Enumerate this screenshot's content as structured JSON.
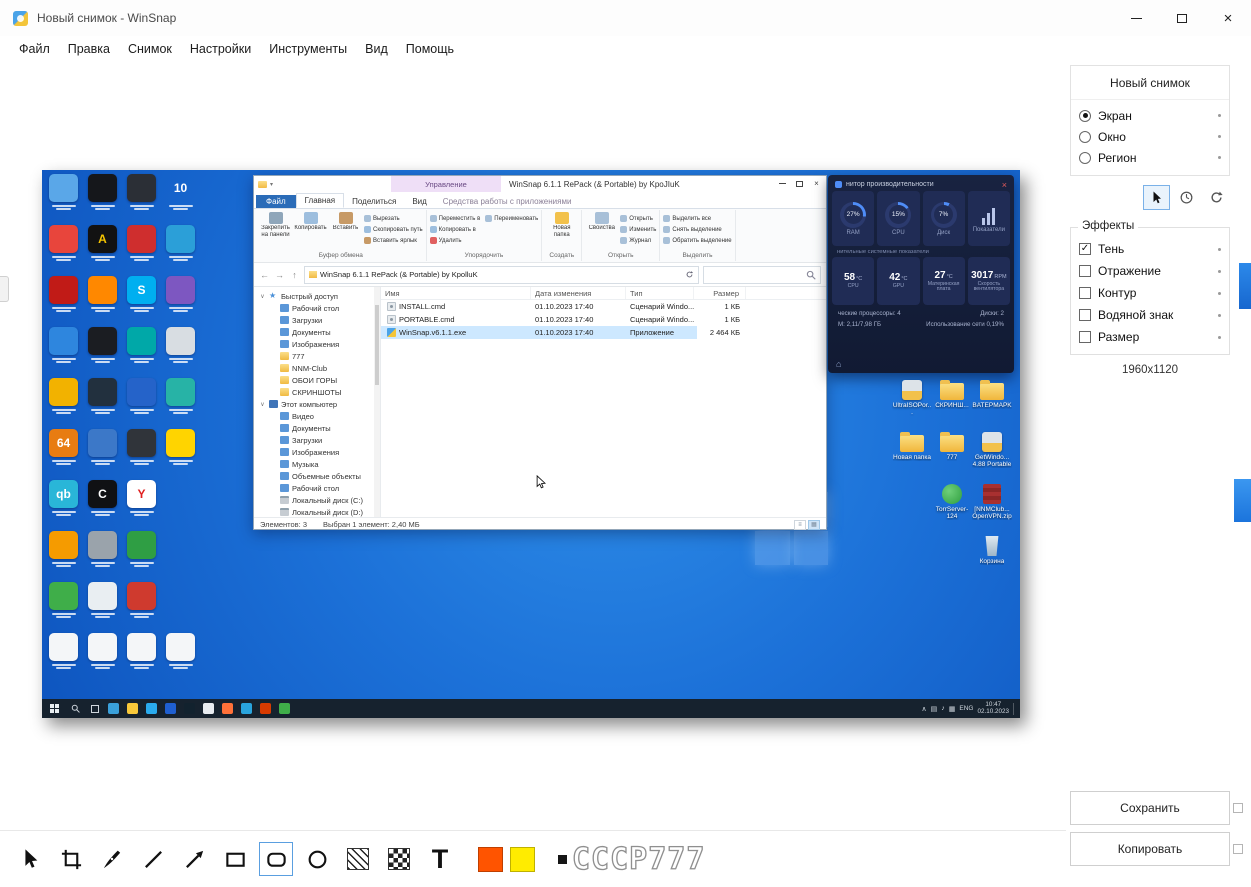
{
  "app": {
    "title": "Новый снимок - WinSnap",
    "close_glyph": "×"
  },
  "menu": {
    "items": [
      "Файл",
      "Правка",
      "Снимок",
      "Настройки",
      "Инструменты",
      "Вид",
      "Помощь"
    ]
  },
  "sidebar": {
    "capture": {
      "title": "Новый снимок",
      "modes": [
        {
          "label": "Экран",
          "selected": true
        },
        {
          "label": "Окно",
          "selected": false
        },
        {
          "label": "Регион",
          "selected": false
        }
      ]
    },
    "effects": {
      "title": "Эффекты",
      "items": [
        {
          "label": "Тень",
          "checked": true
        },
        {
          "label": "Отражение",
          "checked": false
        },
        {
          "label": "Контур",
          "checked": false
        },
        {
          "label": "Водяной знак",
          "checked": false
        },
        {
          "label": "Размер",
          "checked": false
        }
      ]
    },
    "resolution": "1960x1120",
    "save_label": "Сохранить",
    "copy_label": "Копировать"
  },
  "toolbar": {
    "text_tool_label": "T",
    "stroke_color": "#ff5400",
    "fill_color": "#ffec00",
    "font_sample": "CCCP777"
  },
  "preview": {
    "explorer": {
      "contextual_header": "Управление",
      "title": "WinSnap 6.1.1 RePack (& Portable) by KpoJIuK",
      "tabs": [
        {
          "label": "Файл",
          "kind": "file"
        },
        {
          "label": "Главная",
          "kind": "selected"
        },
        {
          "label": "Поделиться",
          "kind": "normal"
        },
        {
          "label": "Вид",
          "kind": "normal"
        },
        {
          "label": "Средства работы с приложениями",
          "kind": "contextual"
        }
      ],
      "ribbon_groups": [
        {
          "caption": "Буфер обмена",
          "big": [
            "Закрепить на панели быстрого доступа",
            "Копировать",
            "Вставить"
          ],
          "small": [
            "Вырезать",
            "Скопировать путь",
            "Вставить ярлык"
          ]
        },
        {
          "caption": "Упорядочить",
          "big": [],
          "small": [
            "Переместить в",
            "Копировать в",
            "Удалить",
            "Переименовать"
          ]
        },
        {
          "caption": "Создать",
          "big": [
            "Новая папка"
          ],
          "small": []
        },
        {
          "caption": "Открыть",
          "big": [
            "Свойства"
          ],
          "small": [
            "Открыть",
            "Изменить",
            "Журнал"
          ]
        },
        {
          "caption": "Выделить",
          "big": [],
          "small": [
            "Выделить все",
            "Снять выделение",
            "Обратить выделение"
          ]
        }
      ],
      "address": "WinSnap 6.1.1 RePack (& Portable) by KpolluK",
      "nav": [
        {
          "label": "Быстрый доступ",
          "icon": "star",
          "level": 0
        },
        {
          "label": "Рабочий стол",
          "icon": "desktop",
          "level": 1
        },
        {
          "label": "Загрузки",
          "icon": "download",
          "level": 1
        },
        {
          "label": "Документы",
          "icon": "doc",
          "level": 1
        },
        {
          "label": "Изображения",
          "icon": "pic",
          "level": 1
        },
        {
          "label": "777",
          "icon": "folder",
          "level": 1
        },
        {
          "label": "NNM-Club",
          "icon": "folder",
          "level": 1
        },
        {
          "label": "ОБОИ ГОРЫ",
          "icon": "folder",
          "level": 1
        },
        {
          "label": "СКРИНШОТЫ",
          "icon": "folder",
          "level": 1
        },
        {
          "label": "Этот компьютер",
          "icon": "pc",
          "level": 0
        },
        {
          "label": "Видео",
          "icon": "video",
          "level": 1
        },
        {
          "label": "Документы",
          "icon": "doc",
          "level": 1
        },
        {
          "label": "Загрузки",
          "icon": "download",
          "level": 1
        },
        {
          "label": "Изображения",
          "icon": "pic",
          "level": 1
        },
        {
          "label": "Музыка",
          "icon": "music",
          "level": 1
        },
        {
          "label": "Объемные объекты",
          "icon": "cube",
          "level": 1
        },
        {
          "label": "Рабочий стол",
          "icon": "desktop",
          "level": 1
        },
        {
          "label": "Локальный диск (C:)",
          "icon": "disk",
          "level": 1
        },
        {
          "label": "Локальный диск (D:)",
          "icon": "disk",
          "level": 1
        }
      ],
      "columns": [
        "Имя",
        "Дата изменения",
        "Тип",
        "Размер"
      ],
      "files": [
        {
          "name": "INSTALL.cmd",
          "date": "01.10.2023 17:40",
          "type": "Сценарий Windo...",
          "size": "1 КБ",
          "icon": "cmd",
          "selected": false
        },
        {
          "name": "PORTABLE.cmd",
          "date": "01.10.2023 17:40",
          "type": "Сценарий Windo...",
          "size": "1 КБ",
          "icon": "cmd",
          "selected": false
        },
        {
          "name": "WinSnap.v6.1.1.exe",
          "date": "01.10.2023 17:40",
          "type": "Приложение",
          "size": "2 464 КБ",
          "icon": "app",
          "selected": true
        }
      ],
      "status_items": "Элементов: 3",
      "status_selection": "Выбран 1 элемент: 2,40 МБ"
    },
    "perf": {
      "title": "нитор производительности",
      "gauges": [
        {
          "value": "27%",
          "label": "RAM",
          "pct": 27
        },
        {
          "value": "15%",
          "label": "CPU",
          "pct": 15
        },
        {
          "value": "7%",
          "label": "Диск",
          "pct": 7
        },
        {
          "value": "",
          "label": "Показатели",
          "pct": 0
        }
      ],
      "subtitle": "нительные системные показатели",
      "temps": [
        {
          "value": "58",
          "unit": "°C",
          "label": "CPU"
        },
        {
          "value": "42",
          "unit": "°C",
          "label": "GPU"
        },
        {
          "value": "27",
          "unit": "°C",
          "label": "Материнская плата"
        },
        {
          "value": "3017",
          "unit": "RPM",
          "label": "Скорость вентилятора"
        }
      ],
      "info_rows": [
        [
          "ческие процессоры: 4",
          "Диски: 2"
        ],
        [
          "М: 2,11/7,98 ГБ",
          "Использование сети 0,19%"
        ]
      ]
    },
    "desktop_left_icons": [
      {
        "c": "#5aa7e8"
      },
      {
        "c": "#15171b"
      },
      {
        "c": "#2b2f36"
      },
      {
        "c": "none",
        "g": "10",
        "gc": "#ffffff"
      },
      {
        "c": "#e8453c"
      },
      {
        "c": "#121212",
        "g": "A",
        "gc": "#f5c400"
      },
      {
        "c": "#cf2e2e"
      },
      {
        "c": "#2b9fd8"
      },
      {
        "c": "#c11b17"
      },
      {
        "c": "#ff8800"
      },
      {
        "c": "#00aff0",
        "g": "S"
      },
      {
        "c": "#7d57c1"
      },
      {
        "c": "#2e86de"
      },
      {
        "c": "#1b1d22"
      },
      {
        "c": "#00a8a8"
      },
      {
        "c": "#d8dde2"
      },
      {
        "c": "#f2b200"
      },
      {
        "c": "#22303e"
      },
      {
        "c": "#2563c9"
      },
      {
        "c": "#27b3a6"
      },
      {
        "c": "#e87c12",
        "g": "64"
      },
      {
        "c": "#3c78c8"
      },
      {
        "c": "#30343a"
      },
      {
        "c": "#ffd400"
      },
      {
        "c": "#29b6d8",
        "g": "qb"
      },
      {
        "c": "#101114",
        "g": "C"
      },
      {
        "c": "#ffffff",
        "g": "Y",
        "gc": "#e02020"
      },
      {
        "c": "none"
      },
      {
        "c": "#f59b00"
      },
      {
        "c": "#9aa3ab"
      },
      {
        "c": "#2f9e44"
      },
      {
        "c": "none"
      },
      {
        "c": "#3fae49"
      },
      {
        "c": "#e9eef2"
      },
      {
        "c": "#cf3a2e"
      },
      {
        "c": "none"
      },
      {
        "c": "#f4f6f8"
      },
      {
        "c": "#f4f6f8"
      },
      {
        "c": "#f4f6f8"
      },
      {
        "c": "#f4f6f8"
      }
    ],
    "desktop_right": [
      {
        "label": "UltraISOPor...",
        "kind": "app",
        "col": 0,
        "row": 0
      },
      {
        "label": "СКРИНШ...",
        "kind": "folder",
        "col": 1,
        "row": 0
      },
      {
        "label": "BATEPMAPK",
        "kind": "folder",
        "col": 2,
        "row": 0
      },
      {
        "label": "Новая папка",
        "kind": "folder",
        "col": 0,
        "row": 1
      },
      {
        "label": "777",
        "kind": "folder",
        "col": 1,
        "row": 1
      },
      {
        "label": "GetWindo... 4.88 Portable",
        "kind": "app",
        "col": 2,
        "row": 1
      },
      {
        "label": "TorrServer-124",
        "kind": "green",
        "col": 1,
        "row": 2
      },
      {
        "label": "[NNMClub...OpenVPN.zip",
        "kind": "zip",
        "col": 2,
        "row": 2
      },
      {
        "label": "Корзина",
        "kind": "bin",
        "col": 2,
        "row": 3
      }
    ],
    "taskbar": {
      "lang": "ENG",
      "time": "10:47",
      "date": "02.10.2023",
      "app_colors": [
        "#3aa0da",
        "#f8c83a",
        "#2aabee",
        "#1f5fd0",
        "#12222e",
        "#e8ecf0",
        "#ff7139",
        "#29a4dd",
        "#d83b01",
        "#3fae49"
      ]
    }
  }
}
